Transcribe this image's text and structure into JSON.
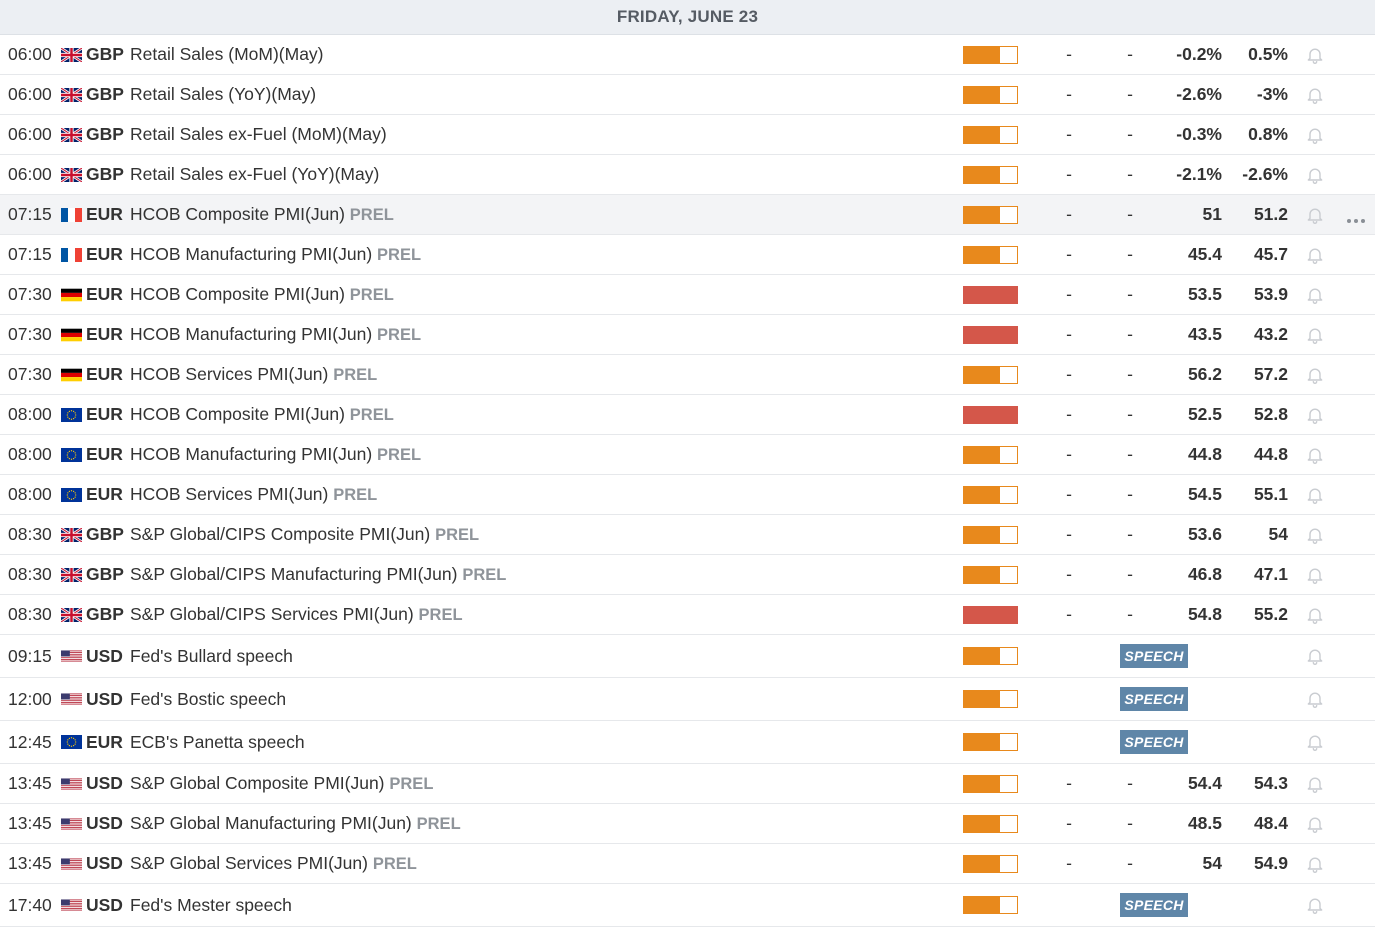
{
  "day_header": "FRIDAY, JUNE 23",
  "colors": {
    "impact_medium": "#e8891c",
    "impact_high": "#d4574a",
    "speech_badge": "#5f86a8",
    "bell": "#c9ccd1"
  },
  "events": [
    {
      "time": "06:00",
      "flag": "gb",
      "currency": "GBP",
      "name": "Retail Sales (MoM)(May)",
      "tag": "",
      "impact": "medium",
      "impact_level": 0.67,
      "actual": "-",
      "consensus": "-",
      "previous": "-0.2%",
      "revised": "0.5%",
      "bell_icon": "bell-icon"
    },
    {
      "time": "06:00",
      "flag": "gb",
      "currency": "GBP",
      "name": "Retail Sales (YoY)(May)",
      "tag": "",
      "impact": "medium",
      "impact_level": 0.67,
      "actual": "-",
      "consensus": "-",
      "previous": "-2.6%",
      "revised": "-3%",
      "bell_icon": "bell-icon"
    },
    {
      "time": "06:00",
      "flag": "gb",
      "currency": "GBP",
      "name": "Retail Sales ex-Fuel (MoM)(May)",
      "tag": "",
      "impact": "medium",
      "impact_level": 0.67,
      "actual": "-",
      "consensus": "-",
      "previous": "-0.3%",
      "revised": "0.8%",
      "bell_icon": "bell-icon"
    },
    {
      "time": "06:00",
      "flag": "gb",
      "currency": "GBP",
      "name": "Retail Sales ex-Fuel (YoY)(May)",
      "tag": "",
      "impact": "medium",
      "impact_level": 0.67,
      "actual": "-",
      "consensus": "-",
      "previous": "-2.1%",
      "revised": "-2.6%",
      "bell_icon": "bell-icon"
    },
    {
      "time": "07:15",
      "flag": "fr",
      "currency": "EUR",
      "name": "HCOB Composite PMI(Jun)",
      "tag": "PREL",
      "impact": "medium",
      "impact_level": 0.67,
      "actual": "-",
      "consensus": "-",
      "previous": "51",
      "revised": "51.2",
      "highlight": true,
      "more_icon": "more-dots-icon",
      "bell_icon": "bell-icon"
    },
    {
      "time": "07:15",
      "flag": "fr",
      "currency": "EUR",
      "name": "HCOB Manufacturing PMI(Jun)",
      "tag": "PREL",
      "impact": "medium",
      "impact_level": 0.67,
      "actual": "-",
      "consensus": "-",
      "previous": "45.4",
      "revised": "45.7",
      "bell_icon": "bell-icon"
    },
    {
      "time": "07:30",
      "flag": "de",
      "currency": "EUR",
      "name": "HCOB Composite PMI(Jun)",
      "tag": "PREL",
      "impact": "high",
      "impact_level": 1,
      "actual": "-",
      "consensus": "-",
      "previous": "53.5",
      "revised": "53.9",
      "bell_icon": "bell-icon"
    },
    {
      "time": "07:30",
      "flag": "de",
      "currency": "EUR",
      "name": "HCOB Manufacturing PMI(Jun)",
      "tag": "PREL",
      "impact": "high",
      "impact_level": 1,
      "actual": "-",
      "consensus": "-",
      "previous": "43.5",
      "revised": "43.2",
      "bell_icon": "bell-icon"
    },
    {
      "time": "07:30",
      "flag": "de",
      "currency": "EUR",
      "name": "HCOB Services PMI(Jun)",
      "tag": "PREL",
      "impact": "medium",
      "impact_level": 0.67,
      "actual": "-",
      "consensus": "-",
      "previous": "56.2",
      "revised": "57.2",
      "bell_icon": "bell-icon"
    },
    {
      "time": "08:00",
      "flag": "eu",
      "currency": "EUR",
      "name": "HCOB Composite PMI(Jun)",
      "tag": "PREL",
      "impact": "high",
      "impact_level": 1,
      "actual": "-",
      "consensus": "-",
      "previous": "52.5",
      "revised": "52.8",
      "bell_icon": "bell-icon"
    },
    {
      "time": "08:00",
      "flag": "eu",
      "currency": "EUR",
      "name": "HCOB Manufacturing PMI(Jun)",
      "tag": "PREL",
      "impact": "medium",
      "impact_level": 0.67,
      "actual": "-",
      "consensus": "-",
      "previous": "44.8",
      "revised": "44.8",
      "bell_icon": "bell-icon"
    },
    {
      "time": "08:00",
      "flag": "eu",
      "currency": "EUR",
      "name": "HCOB Services PMI(Jun)",
      "tag": "PREL",
      "impact": "medium",
      "impact_level": 0.67,
      "actual": "-",
      "consensus": "-",
      "previous": "54.5",
      "revised": "55.1",
      "bell_icon": "bell-icon"
    },
    {
      "time": "08:30",
      "flag": "gb",
      "currency": "GBP",
      "name": "S&P Global/CIPS Composite PMI(Jun)",
      "tag": "PREL",
      "impact": "medium",
      "impact_level": 0.67,
      "actual": "-",
      "consensus": "-",
      "previous": "53.6",
      "revised": "54",
      "bell_icon": "bell-icon"
    },
    {
      "time": "08:30",
      "flag": "gb",
      "currency": "GBP",
      "name": "S&P Global/CIPS Manufacturing PMI(Jun)",
      "tag": "PREL",
      "impact": "medium",
      "impact_level": 0.67,
      "actual": "-",
      "consensus": "-",
      "previous": "46.8",
      "revised": "47.1",
      "bell_icon": "bell-icon"
    },
    {
      "time": "08:30",
      "flag": "gb",
      "currency": "GBP",
      "name": "S&P Global/CIPS Services PMI(Jun)",
      "tag": "PREL",
      "impact": "high",
      "impact_level": 1,
      "actual": "-",
      "consensus": "-",
      "previous": "54.8",
      "revised": "55.2",
      "bell_icon": "bell-icon"
    },
    {
      "time": "09:15",
      "flag": "us",
      "currency": "USD",
      "name": "Fed's Bullard speech",
      "tag": "",
      "impact": "medium",
      "impact_level": 0.67,
      "speech": "SPEECH",
      "bell_icon": "bell-icon"
    },
    {
      "time": "12:00",
      "flag": "us",
      "currency": "USD",
      "name": "Fed's Bostic speech",
      "tag": "",
      "impact": "medium",
      "impact_level": 0.67,
      "speech": "SPEECH",
      "bell_icon": "bell-icon"
    },
    {
      "time": "12:45",
      "flag": "eu",
      "currency": "EUR",
      "name": "ECB's Panetta speech",
      "tag": "",
      "impact": "medium",
      "impact_level": 0.67,
      "speech": "SPEECH",
      "bell_icon": "bell-icon"
    },
    {
      "time": "13:45",
      "flag": "us",
      "currency": "USD",
      "name": "S&P Global Composite PMI(Jun)",
      "tag": "PREL",
      "impact": "medium",
      "impact_level": 0.67,
      "actual": "-",
      "consensus": "-",
      "previous": "54.4",
      "revised": "54.3",
      "bell_icon": "bell-icon"
    },
    {
      "time": "13:45",
      "flag": "us",
      "currency": "USD",
      "name": "S&P Global Manufacturing PMI(Jun)",
      "tag": "PREL",
      "impact": "medium",
      "impact_level": 0.67,
      "actual": "-",
      "consensus": "-",
      "previous": "48.5",
      "revised": "48.4",
      "bell_icon": "bell-icon"
    },
    {
      "time": "13:45",
      "flag": "us",
      "currency": "USD",
      "name": "S&P Global Services PMI(Jun)",
      "tag": "PREL",
      "impact": "medium",
      "impact_level": 0.67,
      "actual": "-",
      "consensus": "-",
      "previous": "54",
      "revised": "54.9",
      "bell_icon": "bell-icon"
    },
    {
      "time": "17:40",
      "flag": "us",
      "currency": "USD",
      "name": "Fed's Mester speech",
      "tag": "",
      "impact": "medium",
      "impact_level": 0.67,
      "speech": "SPEECH",
      "bell_icon": "bell-icon"
    }
  ]
}
